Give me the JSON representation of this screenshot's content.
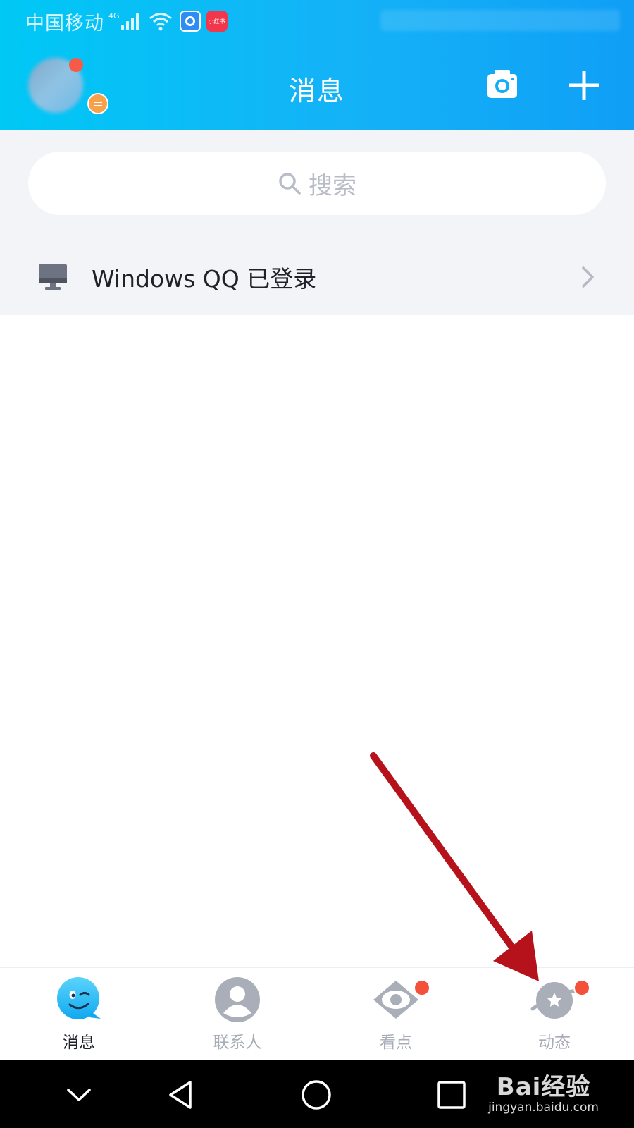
{
  "status_bar": {
    "carrier": "中国移动",
    "network_type": "4G",
    "app_badge_2_text": "小红书"
  },
  "header": {
    "title": "消息",
    "camera_icon": "camera-icon",
    "add_icon": "plus-icon"
  },
  "search": {
    "placeholder": "搜索"
  },
  "login_notice": {
    "text": "Windows QQ 已登录",
    "icon": "monitor-icon"
  },
  "bottom_nav": {
    "items": [
      {
        "label": "消息",
        "icon": "qq-message-icon",
        "active": true
      },
      {
        "label": "联系人",
        "icon": "contacts-icon",
        "active": false
      },
      {
        "label": "看点",
        "icon": "eye-icon",
        "active": false
      },
      {
        "label": "动态",
        "icon": "planet-star-icon",
        "active": false
      }
    ]
  },
  "watermark": {
    "main": "Bai经验",
    "sub": "jingyan.baidu.com"
  },
  "colors": {
    "header_start": "#00c8f5",
    "header_end": "#0f9ff6",
    "badge_red": "#f4513b",
    "arrow_red": "#b5121b",
    "inactive_gray": "#a7acb6"
  }
}
